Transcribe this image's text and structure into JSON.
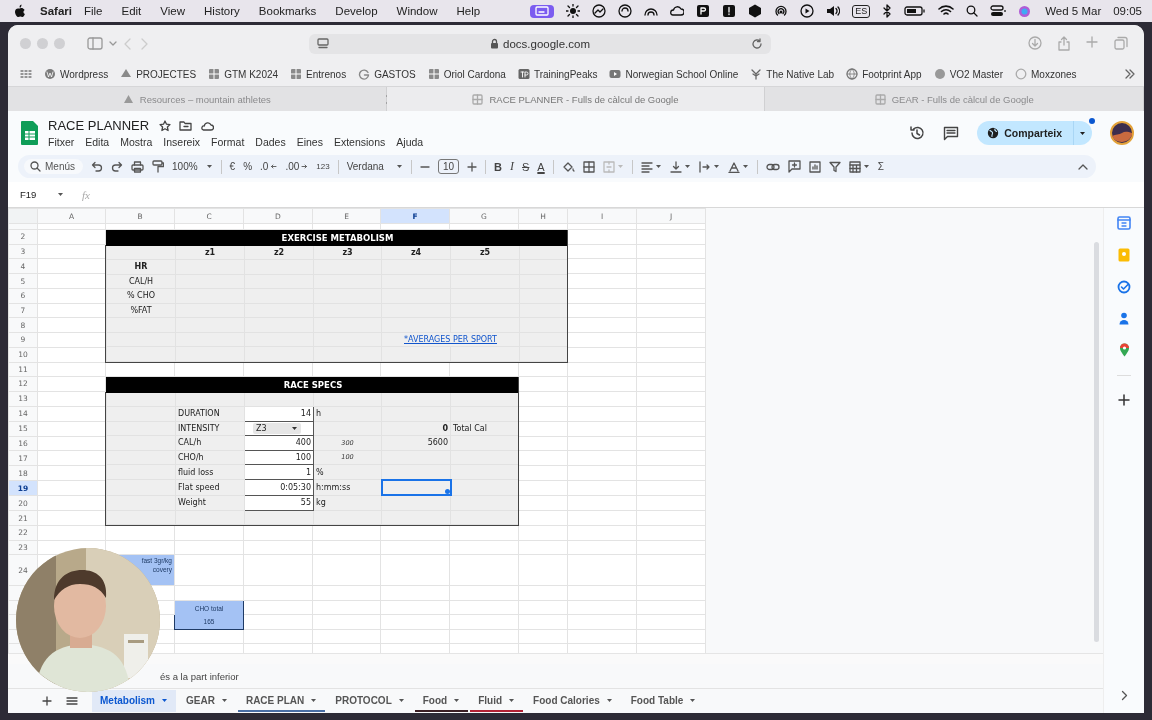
{
  "menubar": {
    "app": "Safari",
    "menus": [
      "File",
      "Edit",
      "View",
      "History",
      "Bookmarks",
      "Develop",
      "Window",
      "Help"
    ],
    "input_source": "ES",
    "date": "Wed 5 Mar",
    "time": "09:05"
  },
  "browser": {
    "address": "docs.google.com",
    "bookmarks": [
      {
        "label": "Wordpress",
        "kind": "wp"
      },
      {
        "label": "PROJECTES",
        "kind": "drive"
      },
      {
        "label": "GTM K2024",
        "kind": "sheet"
      },
      {
        "label": "Entrenos",
        "kind": "sheet"
      },
      {
        "label": "GASTOS",
        "kind": "g"
      },
      {
        "label": "Oriol Cardona",
        "kind": "sheet"
      },
      {
        "label": "TrainingPeaks",
        "kind": "tp"
      },
      {
        "label": "Norwegian School Online",
        "kind": "play"
      },
      {
        "label": "The Native Lab",
        "kind": "leaf"
      },
      {
        "label": "Footprint App",
        "kind": "globe"
      },
      {
        "label": "VO2 Master",
        "kind": "dot"
      },
      {
        "label": "Moxzones",
        "kind": "ring"
      }
    ],
    "tabs": [
      {
        "title": "Resources – mountain athletes",
        "selected": false,
        "kind": "triangle"
      },
      {
        "title": "RACE PLANNER - Fulls de càlcul de Google",
        "selected": true,
        "kind": "sheet"
      },
      {
        "title": "GEAR - Fulls de càlcul de Google",
        "selected": false,
        "kind": "sheet"
      }
    ]
  },
  "docs": {
    "title": "RACE PLANNER",
    "menus": [
      "Fitxer",
      "Edita",
      "Mostra",
      "Insereix",
      "Format",
      "Dades",
      "Eines",
      "Extensions",
      "Ajuda"
    ],
    "share": "Comparteix"
  },
  "toolbar": {
    "search": "Menús",
    "zoom": "100%",
    "currency": "€",
    "percent": "%",
    "decrease_decimals": ".0",
    "increase_decimals": ".00",
    "number_format": "123",
    "font": "Verdana",
    "font_size": "10",
    "bold": "B",
    "italic": "I",
    "strikethrough": "S",
    "text_color": "A",
    "sum": "Σ"
  },
  "formula_bar": {
    "name_box": "F19",
    "fx": "fx"
  },
  "sheet": {
    "columns": [
      {
        "label": "A",
        "selected": false
      },
      {
        "label": "B",
        "selected": false
      },
      {
        "label": "C",
        "selected": false
      },
      {
        "label": "D",
        "selected": false
      },
      {
        "label": "E",
        "selected": false
      },
      {
        "label": "F",
        "selected": true
      },
      {
        "label": "G",
        "selected": false
      },
      {
        "label": "H",
        "selected": false
      },
      {
        "label": "I",
        "selected": false
      },
      {
        "label": "J",
        "selected": false
      }
    ],
    "row_numbers": [
      {
        "label": "2",
        "selected": false
      },
      {
        "label": "3",
        "selected": false
      },
      {
        "label": "4",
        "selected": false
      },
      {
        "label": "5",
        "selected": false
      },
      {
        "label": "6",
        "selected": false
      },
      {
        "label": "7",
        "selected": false
      },
      {
        "label": "8",
        "selected": false
      },
      {
        "label": "9",
        "selected": false
      },
      {
        "label": "10",
        "selected": false
      },
      {
        "label": "11",
        "selected": false
      },
      {
        "label": "12",
        "selected": false
      },
      {
        "label": "13",
        "selected": false
      },
      {
        "label": "14",
        "selected": false
      },
      {
        "label": "15",
        "selected": false
      },
      {
        "label": "16",
        "selected": false
      },
      {
        "label": "17",
        "selected": false
      },
      {
        "label": "18",
        "selected": false
      },
      {
        "label": "19",
        "selected": true
      },
      {
        "label": "20",
        "selected": false
      },
      {
        "label": "21",
        "selected": false
      },
      {
        "label": "22",
        "selected": false
      },
      {
        "label": "23",
        "selected": false
      },
      {
        "label": "24",
        "selected": false
      }
    ],
    "metabolism": {
      "title": "EXERCISE METABOLISM",
      "zones": [
        "z1",
        "z2",
        "z3",
        "z4",
        "z5"
      ],
      "row_labels": [
        {
          "text": "HR",
          "bold": true
        },
        {
          "text": "CAL/H",
          "bold": false
        },
        {
          "text": "% CHO",
          "bold": false
        },
        {
          "text": "%FAT",
          "bold": false
        }
      ],
      "link": "*AVERAGES PER SPORT"
    },
    "race_specs": {
      "title": "RACE SPECS",
      "fields": [
        {
          "label": "DURATION",
          "value": "14",
          "unit": "h",
          "kind": "input"
        },
        {
          "label": "INTENSITY",
          "value": "Z3",
          "kind": "dropdown",
          "result": "0",
          "result_bold": true,
          "result_label": "Total Cal"
        },
        {
          "label": "CAL/h",
          "value": "400",
          "kind": "input",
          "hint": "300",
          "result": "5600",
          "result_bold": false
        },
        {
          "label": "CHO/h",
          "value": "100",
          "kind": "input",
          "hint": "100"
        },
        {
          "label": "fluid loss",
          "value": "1",
          "unit": "%",
          "kind": "input"
        },
        {
          "label": "Flat speed",
          "value": "0:05:30",
          "unit": "h:mm:ss",
          "kind": "input"
        },
        {
          "label": "Weight",
          "value": "55",
          "unit": "kg",
          "kind": "input"
        }
      ]
    },
    "breakfast_cell": [
      "fast 3gr/kg",
      "covery"
    ],
    "cho_total": {
      "label": "CHO total",
      "value": "165"
    },
    "note": "és a la part inferior"
  },
  "sheet_tabs": [
    {
      "name": "Metabolism",
      "selected": true
    },
    {
      "name": "GEAR",
      "selected": false
    },
    {
      "name": "RACE PLAN",
      "selected": false,
      "color": "#4a6fa5"
    },
    {
      "name": "PROTOCOL",
      "selected": false
    },
    {
      "name": "Food",
      "selected": false,
      "color": "#3b1f24"
    },
    {
      "name": "Fluid",
      "selected": false,
      "color": "#b22234"
    },
    {
      "name": "Food Calories",
      "selected": false
    },
    {
      "name": "Food Table",
      "selected": false
    }
  ]
}
